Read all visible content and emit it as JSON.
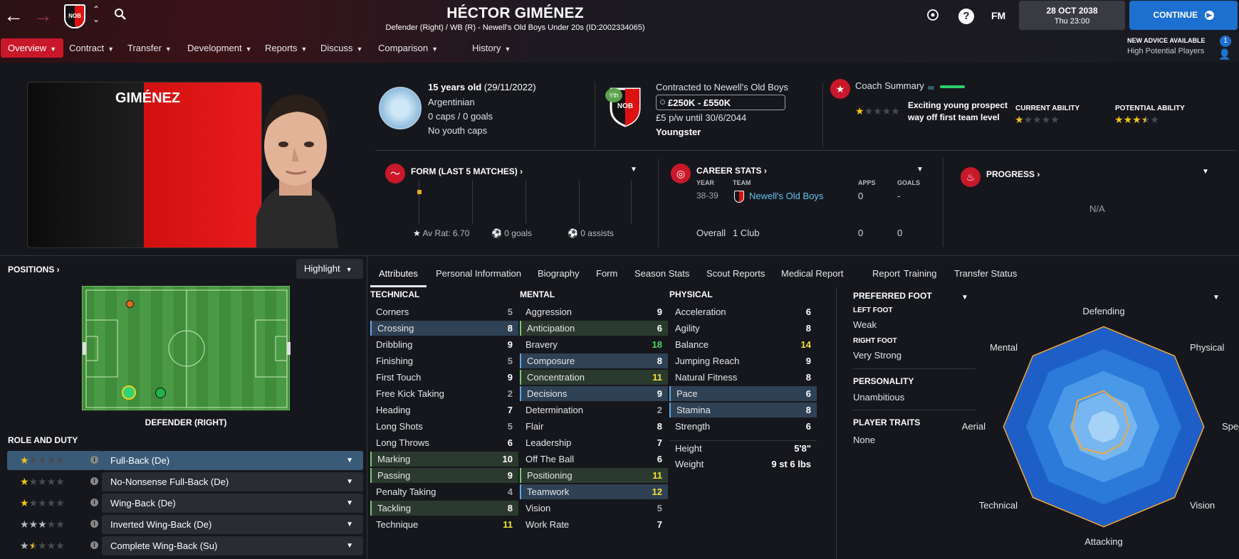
{
  "header": {
    "player_name": "HÉCTOR GIMÉNEZ",
    "subtitle": "Defender (Right) / WB (R) - Newell's Old Boys Under 20s (ID:2002334065)",
    "club_badge_text": "NOB",
    "fm_label": "FM",
    "date": "28 OCT 2038",
    "time": "Thu 23:00",
    "continue_label": "CONTINUE"
  },
  "menu": {
    "items": [
      {
        "label": "Overview"
      },
      {
        "label": "Contract"
      },
      {
        "label": "Transfer"
      },
      {
        "label": "Development"
      },
      {
        "label": "Reports"
      },
      {
        "label": "Discuss"
      },
      {
        "label": "Comparison"
      },
      {
        "label": "History"
      }
    ]
  },
  "advice": {
    "title": "NEW ADVICE AVAILABLE",
    "detail": "High Potential Players",
    "count": "1"
  },
  "card": {
    "surname": "GIMÉNEZ"
  },
  "bio": {
    "age": "15 years old",
    "dob": "(29/11/2022)",
    "nationality": "Argentinian",
    "caps": "0 caps / 0 goals",
    "youth_caps": "No youth caps"
  },
  "contract": {
    "yth_badge": "Yth",
    "club_text": "Contracted to Newell's Old Boys",
    "value_range": "£250K - £550K",
    "wage": "£5 p/w until 30/6/2044",
    "status": "Youngster"
  },
  "coach": {
    "title": "Coach Summary",
    "summary_line1": "Exciting young prospect",
    "summary_line2": "way off first team level",
    "summary_stars": 1,
    "current_ability_label": "CURRENT ABILITY",
    "current_ability_stars": 1,
    "potential_ability_label": "POTENTIAL ABILITY",
    "potential_ability_stars": 3.5
  },
  "form": {
    "title": "FORM (LAST 5 MATCHES)",
    "av_rat": "Av Rat: 6.70",
    "goals": "0 goals",
    "assists": "0 assists"
  },
  "career": {
    "title": "CAREER STATS",
    "col_year": "YEAR",
    "col_team": "TEAM",
    "col_apps": "APPS",
    "col_goals": "GOALS",
    "row_year": "38-39",
    "row_team": "Newell's Old Boys",
    "row_apps": "0",
    "row_goals": "-",
    "overall_label": "Overall",
    "overall_clubs": "1 Club",
    "overall_apps": "0",
    "overall_goals": "0"
  },
  "progress": {
    "title": "PROGRESS",
    "value": "N/A"
  },
  "positions": {
    "title": "POSITIONS",
    "highlight_label": "Highlight",
    "position_label": "DEFENDER (RIGHT)"
  },
  "roles": {
    "title": "ROLE AND DUTY",
    "items": [
      {
        "label": "Full-Back (De)",
        "stars": 1
      },
      {
        "label": "No-Nonsense Full-Back (De)",
        "stars": 1
      },
      {
        "label": "Wing-Back (De)",
        "stars": 1
      },
      {
        "label": "Inverted Wing-Back (De)",
        "stars": 3
      },
      {
        "label": "Complete Wing-Back (Su)",
        "stars": 1.5
      }
    ]
  },
  "tabs": [
    {
      "label": "Attributes"
    },
    {
      "label": "Personal Information"
    },
    {
      "label": "Biography"
    },
    {
      "label": "Form"
    },
    {
      "label": "Season Stats"
    },
    {
      "label": "Scout Reports"
    },
    {
      "label": "Medical Report"
    },
    {
      "label": "Report"
    },
    {
      "label": "Training"
    },
    {
      "label": "Transfer Status"
    }
  ],
  "attributes": {
    "technical_title": "TECHNICAL",
    "mental_title": "MENTAL",
    "physical_title": "PHYSICAL",
    "technical": [
      {
        "name": "Corners",
        "value": "5"
      },
      {
        "name": "Crossing",
        "value": "8"
      },
      {
        "name": "Dribbling",
        "value": "9"
      },
      {
        "name": "Finishing",
        "value": "5"
      },
      {
        "name": "First Touch",
        "value": "9"
      },
      {
        "name": "Free Kick Taking",
        "value": "2"
      },
      {
        "name": "Heading",
        "value": "7"
      },
      {
        "name": "Long Shots",
        "value": "5"
      },
      {
        "name": "Long Throws",
        "value": "6"
      },
      {
        "name": "Marking",
        "value": "10"
      },
      {
        "name": "Passing",
        "value": "9"
      },
      {
        "name": "Penalty Taking",
        "value": "4"
      },
      {
        "name": "Tackling",
        "value": "8"
      },
      {
        "name": "Technique",
        "value": "11"
      }
    ],
    "mental": [
      {
        "name": "Aggression",
        "value": "9"
      },
      {
        "name": "Anticipation",
        "value": "6"
      },
      {
        "name": "Bravery",
        "value": "18"
      },
      {
        "name": "Composure",
        "value": "8"
      },
      {
        "name": "Concentration",
        "value": "11"
      },
      {
        "name": "Decisions",
        "value": "9"
      },
      {
        "name": "Determination",
        "value": "2"
      },
      {
        "name": "Flair",
        "value": "8"
      },
      {
        "name": "Leadership",
        "value": "7"
      },
      {
        "name": "Off The Ball",
        "value": "6"
      },
      {
        "name": "Positioning",
        "value": "11"
      },
      {
        "name": "Teamwork",
        "value": "12"
      },
      {
        "name": "Vision",
        "value": "5"
      },
      {
        "name": "Work Rate",
        "value": "7"
      }
    ],
    "physical": [
      {
        "name": "Acceleration",
        "value": "6"
      },
      {
        "name": "Agility",
        "value": "8"
      },
      {
        "name": "Balance",
        "value": "14"
      },
      {
        "name": "Jumping Reach",
        "value": "9"
      },
      {
        "name": "Natural Fitness",
        "value": "8"
      },
      {
        "name": "Pace",
        "value": "6"
      },
      {
        "name": "Stamina",
        "value": "8"
      },
      {
        "name": "Strength",
        "value": "6"
      }
    ],
    "height_label": "Height",
    "height_value": "5'8\"",
    "weight_label": "Weight",
    "weight_value": "9 st 6 lbs"
  },
  "profile": {
    "preferred_foot_title": "PREFERRED FOOT",
    "left_foot_label": "LEFT FOOT",
    "left_foot_value": "Weak",
    "right_foot_label": "RIGHT FOOT",
    "right_foot_value": "Very Strong",
    "personality_label": "PERSONALITY",
    "personality_value": "Unambitious",
    "traits_label": "PLAYER TRAITS",
    "traits_value": "None"
  },
  "radar": {
    "labels": [
      "Defending",
      "Physical",
      "Speed",
      "Vision",
      "Attacking",
      "Technical",
      "Aerial",
      "Mental"
    ],
    "values": [
      0.36,
      0.28,
      0.25,
      0.25,
      0.27,
      0.31,
      0.32,
      0.37
    ]
  },
  "colors": {
    "accent_red": "#c8182a",
    "continue_blue": "#1d6fd0",
    "star_gold": "#f5c518",
    "radar_line": "#f2a93b"
  }
}
